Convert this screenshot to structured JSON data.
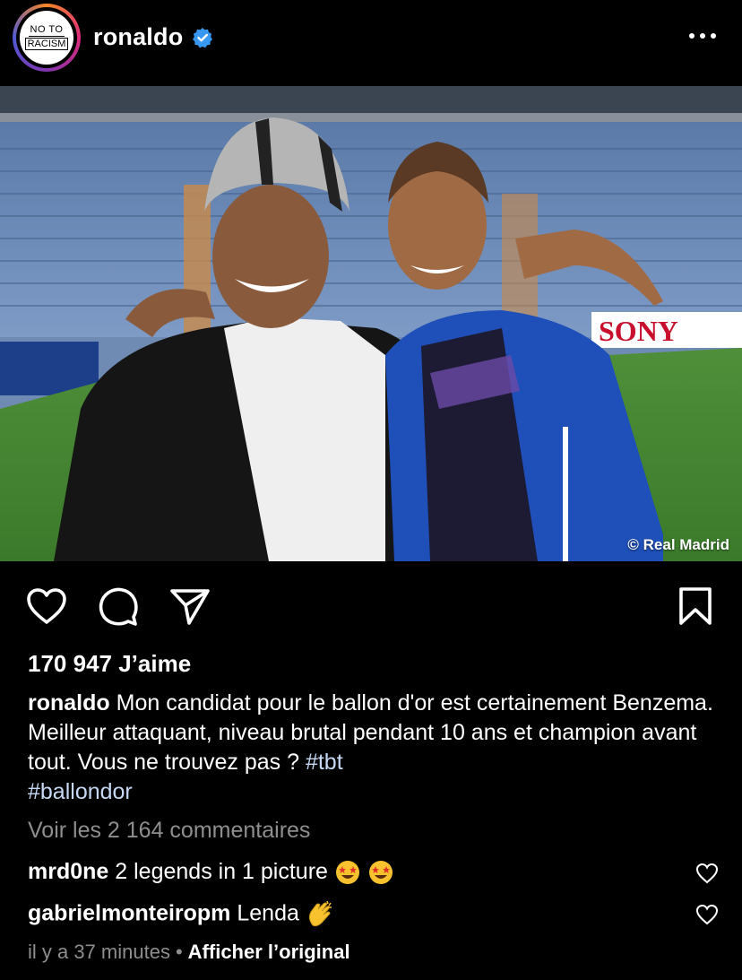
{
  "header": {
    "avatar_text_top": "NO TO",
    "avatar_text_bottom": "RACISM",
    "username": "ronaldo",
    "verified_icon": "verified-badge-icon",
    "more_icon": "more-dots-icon"
  },
  "photo": {
    "credit": "© Real Madrid",
    "sign_text": "SONY"
  },
  "actions": {
    "like_icon": "heart-icon",
    "comment_icon": "comment-icon",
    "share_icon": "send-icon",
    "save_icon": "bookmark-icon"
  },
  "post": {
    "likes": "170 947 J’aime",
    "caption_user": "ronaldo",
    "caption_text": "Mon candidat pour le ballon d'or est certainement Benzema. Meilleur attaquant, niveau brutal pendant 10 ans et champion avant tout. Vous ne trouvez pas ? ",
    "hashtag_1": "#tbt",
    "hashtag_2": "#ballondor",
    "view_comments": "Voir les 2 164 commentaires"
  },
  "comments": [
    {
      "user": "mrd0ne",
      "text": "2 legends in 1 picture",
      "emoji": "star-struck-emoji ×2"
    },
    {
      "user": "gabrielmonteiropm",
      "text": "Lenda",
      "emoji": "clapping-hands-emoji"
    }
  ],
  "meta": {
    "time": "il y a 37 minutes",
    "separator": "•",
    "translate": "Afficher l’original"
  },
  "colors": {
    "background": "#000000",
    "verified": "#3897f0",
    "hashtag": "#c7d8f5",
    "muted": "#8e8e8e"
  }
}
